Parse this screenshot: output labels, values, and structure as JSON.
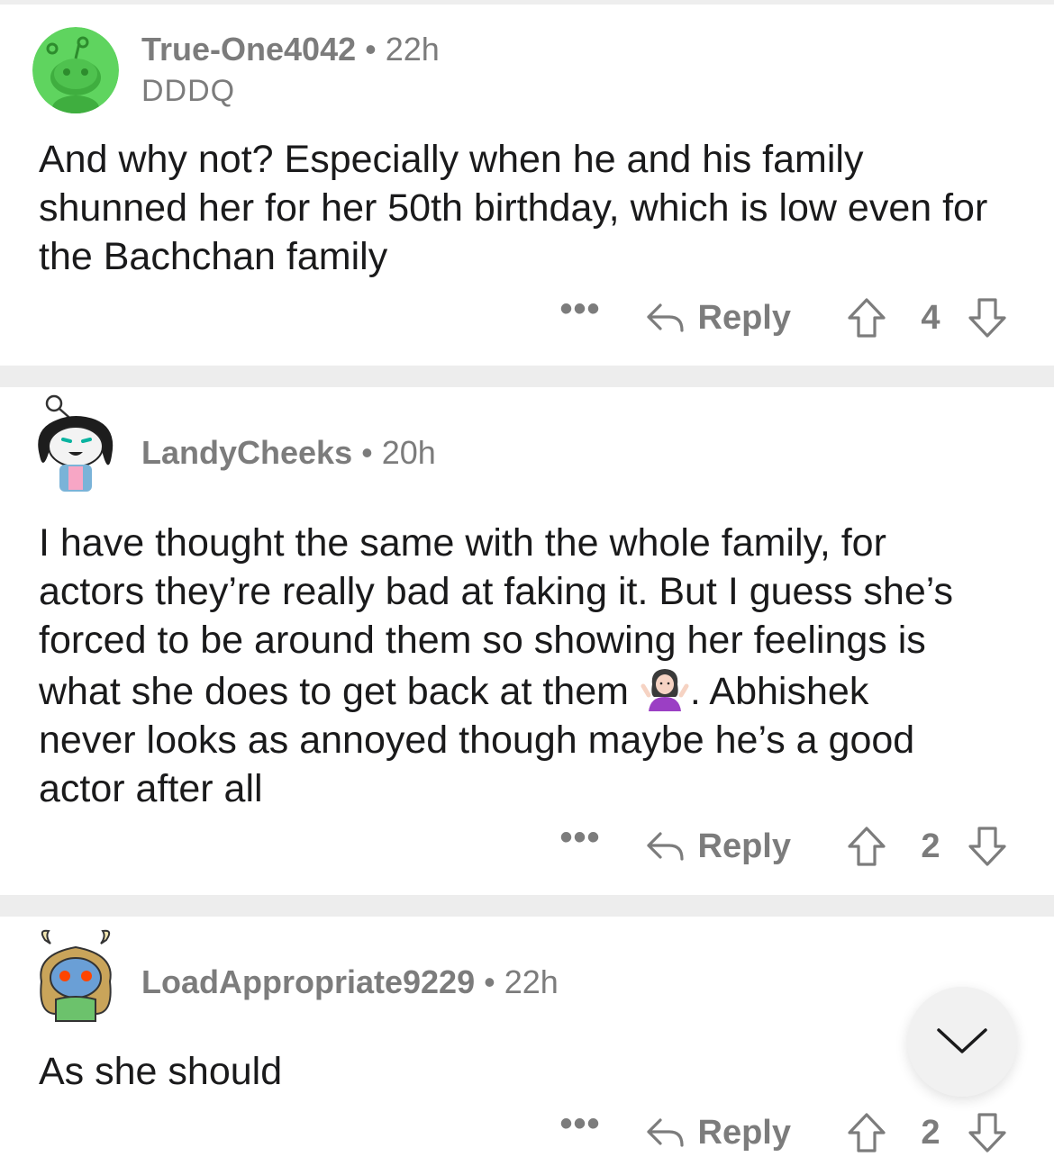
{
  "comments": [
    {
      "username": "True-One4042",
      "separator": "•",
      "age": "22h",
      "flair": "DDDQ",
      "avatar_icon": "snoo-green-avatar-icon",
      "body": "And why not? Especially when he and his family shunned her for her 50th birthday, which is low even for the Bachchan family",
      "more_label": "•••",
      "reply_label": "Reply",
      "score": "4"
    },
    {
      "username": "LandyCheeks",
      "separator": "•",
      "age": "20h",
      "avatar_icon": "snoo-custom-avatar-icon",
      "body_before_emoji": "I have thought the same with the whole family, for actors they’re really bad at faking it. But I guess she’s forced to be around them so showing her feelings is what she does to get back at them ",
      "emoji_icon": "shrugging-woman-emoji-icon",
      "body_after_emoji": ". Abhishek never looks as annoyed though maybe he’s a good actor after all",
      "more_label": "•••",
      "reply_label": "Reply",
      "score": "2"
    },
    {
      "username": "LoadAppropriate9229",
      "separator": "•",
      "age": "22h",
      "avatar_icon": "snoo-blue-viking-avatar-icon",
      "body": "As she should",
      "more_label": "•••",
      "reply_label": "Reply",
      "score": "2"
    }
  ],
  "jump_button_icon": "chevron-down-icon",
  "colors": {
    "text": "#1a1a1b",
    "meta": "#7c7c7c",
    "divider": "#ededed",
    "avatar_green": "#5fd45f"
  }
}
